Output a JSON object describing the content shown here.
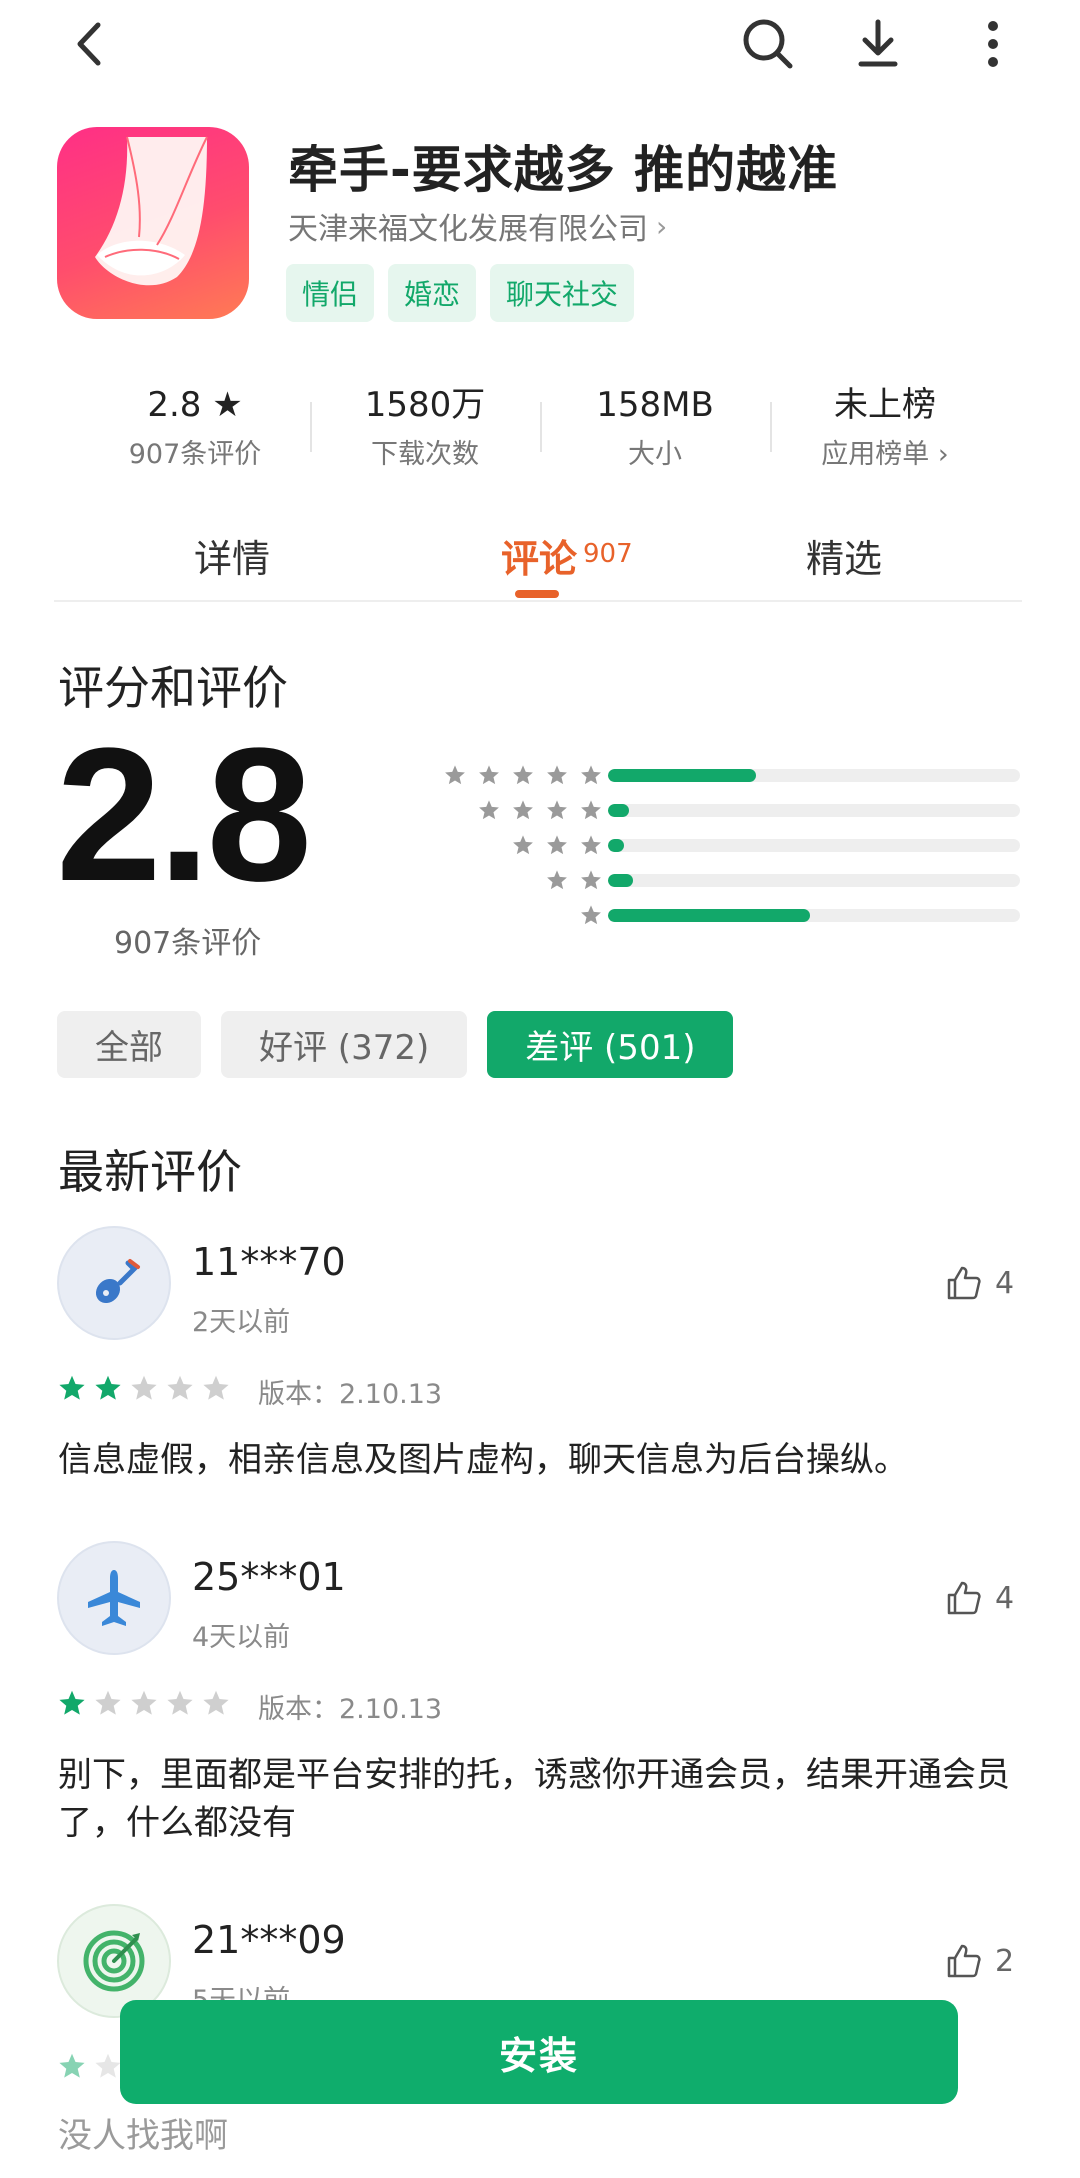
{
  "app": {
    "title": "牵手-要求越多 推的越准",
    "developer": "天津来福文化发展有限公司",
    "tags": [
      "情侣",
      "婚恋",
      "聊天社交"
    ]
  },
  "stats": [
    {
      "value": "2.8 ★",
      "label": "907条评价"
    },
    {
      "value": "1580万",
      "label": "下载次数"
    },
    {
      "value": "158MB",
      "label": "大小"
    },
    {
      "value": "未上榜",
      "label": "应用榜单 ›"
    }
  ],
  "tabs": {
    "details": "详情",
    "reviews": "评论",
    "reviews_count": "907",
    "featured": "精选"
  },
  "ratings": {
    "heading": "评分和评价",
    "score": "2.8",
    "count_label": "907条评价",
    "distribution": [
      {
        "stars": 5,
        "fraction": 0.36
      },
      {
        "stars": 4,
        "fraction": 0.05
      },
      {
        "stars": 3,
        "fraction": 0.04
      },
      {
        "stars": 2,
        "fraction": 0.06
      },
      {
        "stars": 1,
        "fraction": 0.49
      }
    ]
  },
  "filters": [
    {
      "label": "全部",
      "active": false
    },
    {
      "label": "好评 (372)",
      "active": false
    },
    {
      "label": "差评 (501)",
      "active": true
    }
  ],
  "latest": {
    "heading": "最新评价",
    "reviews": [
      {
        "user": "11***70",
        "ago": "2天以前",
        "likes": "4",
        "rating": 2,
        "version": "版本：2.10.13",
        "text": "信息虚假，相亲信息及图片虚构，聊天信息为后台操纵。",
        "avatar_icon": "guitar-icon"
      },
      {
        "user": "25***01",
        "ago": "4天以前",
        "likes": "4",
        "rating": 1,
        "version": "版本：2.10.13",
        "text": "别下，里面都是平台安排的托，诱惑你开通会员，结果开通会员了，什么都没有",
        "avatar_icon": "airplane-icon"
      },
      {
        "user": "21***09",
        "ago": "5天以前",
        "likes": "2",
        "rating": 1,
        "version": "",
        "text": "没人找我啊",
        "avatar_icon": "target-icon"
      }
    ]
  },
  "install_label": "安装",
  "colors": {
    "accent_green": "#0fad6c",
    "accent_orange": "#e8622a"
  }
}
